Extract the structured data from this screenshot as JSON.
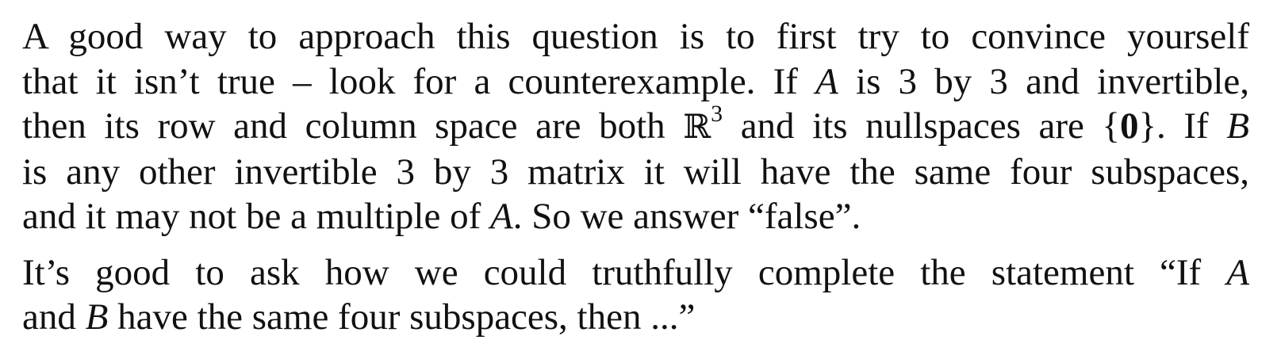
{
  "paragraph1": {
    "l1": "A good way to approach this question is to first try to convince yourself",
    "l2a": "that it isn’t true – look for a counterexample. If ",
    "l2_var": "A",
    "l2b": " is 3 by 3 and invertible,",
    "l3a": "then its row and column space are both ",
    "l3_set": "ℝ",
    "l3_exp": "3",
    "l3b": " and its nullspaces are {",
    "l3_zero": "0",
    "l3c": "}. If ",
    "l3_var": "B",
    "l4": "is any other invertible 3 by 3 matrix it will have the same four subspaces,",
    "l5a": "and it may not be a multiple of ",
    "l5_var": "A",
    "l5b": ". So we answer “false”."
  },
  "paragraph2": {
    "l1a": "It’s good to ask how we could truthfully complete the statement “If ",
    "l1_var": "A",
    "l2a": "and ",
    "l2_var": "B",
    "l2b": " have the same four subspaces, then ...”"
  }
}
